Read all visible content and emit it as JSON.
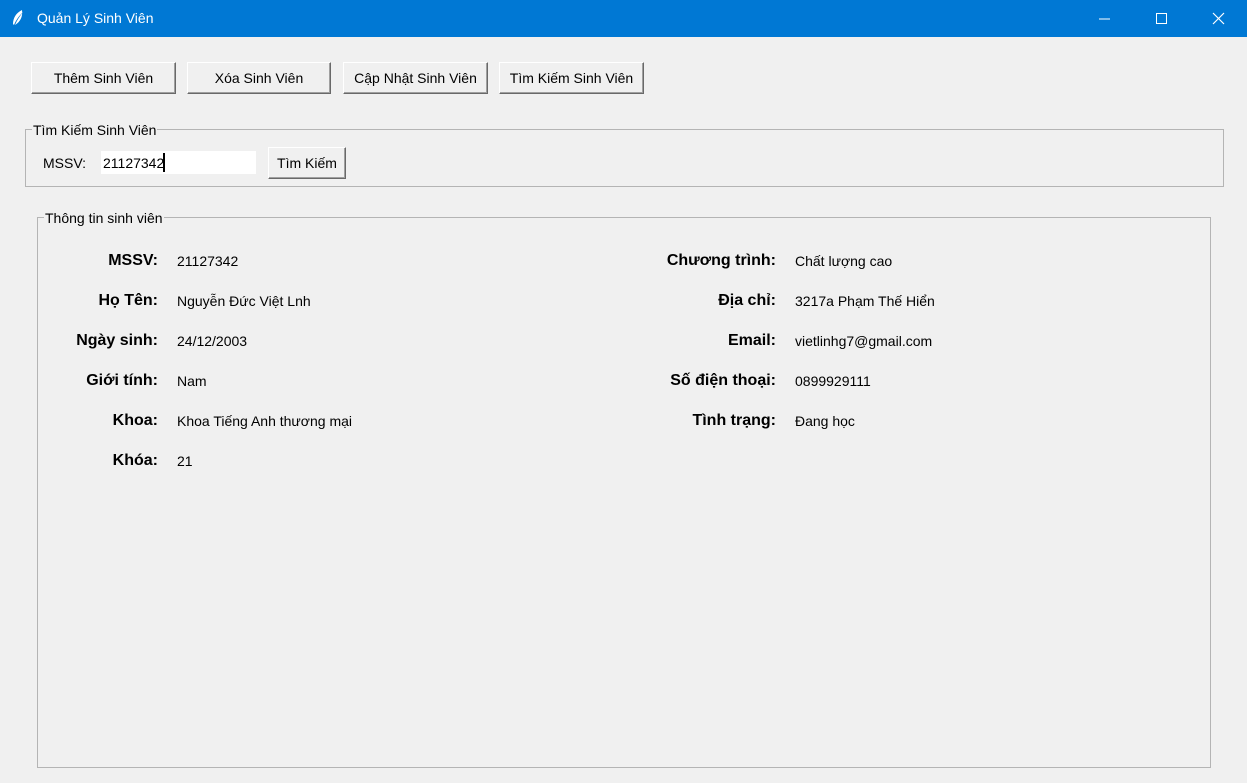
{
  "window": {
    "title": "Quản Lý Sinh Viên",
    "icons": [
      "feather-icon",
      "minimize-icon",
      "maximize-icon",
      "close-icon"
    ],
    "accent": "#0078d4"
  },
  "toolbar": {
    "add": "Thêm Sinh Viên",
    "delete": "Xóa Sinh Viên",
    "update": "Cập Nhật Sinh Viên",
    "search": "Tìm Kiếm Sinh Viên"
  },
  "search_group": {
    "title": "Tìm Kiếm Sinh Viên",
    "mssv_label": "MSSV:",
    "mssv_value": "21127342",
    "button": "Tìm Kiếm"
  },
  "info_group": {
    "title": "Thông tin sinh viên",
    "left": [
      {
        "label": "MSSV:",
        "value": "21127342"
      },
      {
        "label": "Họ Tên:",
        "value": "Nguyễn Đức Việt Lnh"
      },
      {
        "label": "Ngày sinh:",
        "value": "24/12/2003"
      },
      {
        "label": "Giới tính:",
        "value": "Nam"
      },
      {
        "label": "Khoa:",
        "value": "Khoa Tiếng Anh thương mại"
      },
      {
        "label": "Khóa:",
        "value": "21"
      }
    ],
    "right": [
      {
        "label": "Chương trình:",
        "value": "Chất lượng cao"
      },
      {
        "label": "Địa chỉ:",
        "value": "3217a Phạm Thế Hiển"
      },
      {
        "label": "Email:",
        "value": "vietlinhg7@gmail.com"
      },
      {
        "label": "Số điện thoại:",
        "value": "0899929111"
      },
      {
        "label": "Tình trạng:",
        "value": "Đang học"
      }
    ]
  }
}
